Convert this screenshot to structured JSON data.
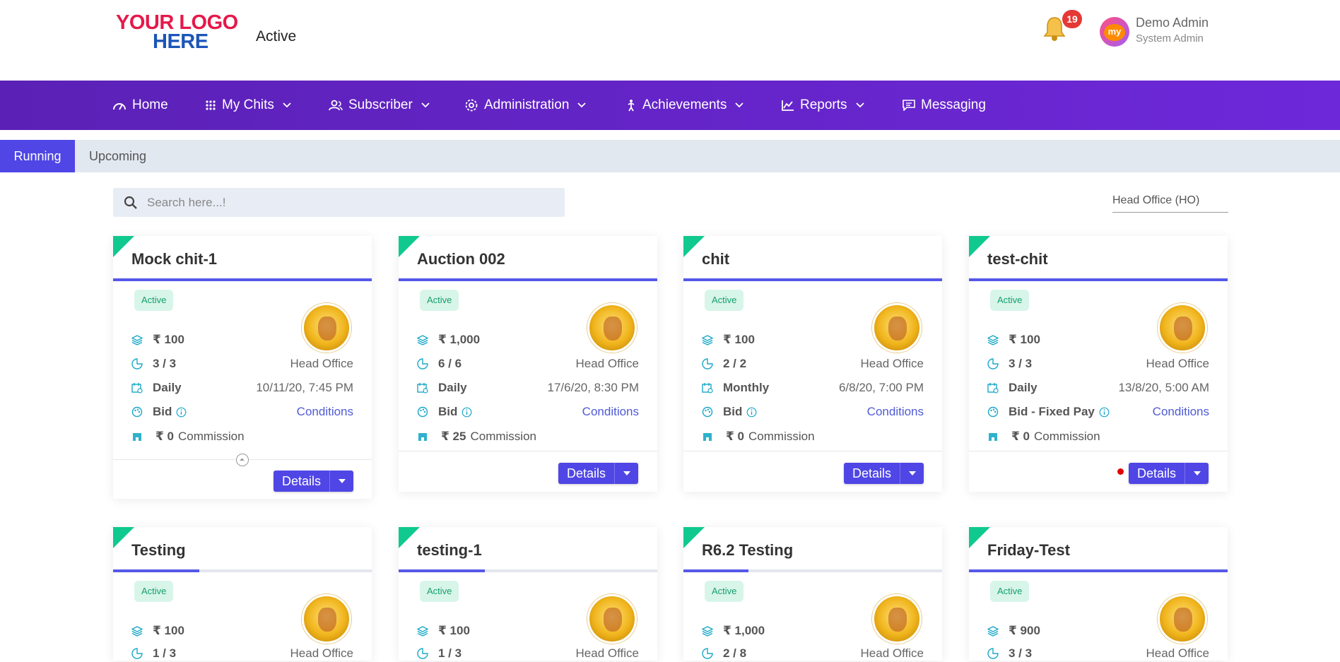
{
  "header": {
    "logo_line1": "YOUR LOGO",
    "logo_line2": "HERE",
    "page_status": "Active",
    "notifications_count": "19",
    "avatar_text": "my",
    "user_name": "Demo Admin",
    "user_role": "System Admin"
  },
  "nav": {
    "items": [
      {
        "label": "Home",
        "icon": "speedometer-icon"
      },
      {
        "label": "My Chits",
        "icon": "grid-icon"
      },
      {
        "label": "Subscriber",
        "icon": "users-icon"
      },
      {
        "label": "Administration",
        "icon": "gear-icon"
      },
      {
        "label": "Achievements",
        "icon": "trophy-icon"
      },
      {
        "label": "Reports",
        "icon": "chart-icon"
      },
      {
        "label": "Messaging",
        "icon": "message-icon"
      }
    ]
  },
  "tabs": {
    "running": "Running",
    "upcoming": "Upcoming"
  },
  "search": {
    "placeholder": "Search here...!"
  },
  "branch_filter": "Head Office (HO)",
  "cards": [
    {
      "title": "Mock chit-1",
      "status": "Active",
      "progress": 1.0,
      "amount": "₹ 100",
      "members": "3 / 3",
      "branch": "Head Office",
      "frequency": "Daily",
      "date": "10/11/20, 7:45 PM",
      "auction_type": "Bid",
      "conditions": "Conditions",
      "commission_value": "₹ 0",
      "commission_label": "Commission",
      "details": "Details"
    },
    {
      "title": "Auction 002",
      "status": "Active",
      "progress": 1.0,
      "amount": "₹ 1,000",
      "members": "6 / 6",
      "branch": "Head Office",
      "frequency": "Daily",
      "date": "17/6/20, 8:30 PM",
      "auction_type": "Bid",
      "conditions": "Conditions",
      "commission_value": "₹ 25",
      "commission_label": "Commission",
      "details": "Details"
    },
    {
      "title": "chit",
      "status": "Active",
      "progress": 1.0,
      "amount": "₹ 100",
      "members": "2 / 2",
      "branch": "Head Office",
      "frequency": "Monthly",
      "date": "6/8/20, 7:00 PM",
      "auction_type": "Bid",
      "conditions": "Conditions",
      "commission_value": "₹ 0",
      "commission_label": "Commission",
      "details": "Details"
    },
    {
      "title": "test-chit",
      "status": "Active",
      "progress": 1.0,
      "amount": "₹ 100",
      "members": "3 / 3",
      "branch": "Head Office",
      "frequency": "Daily",
      "date": "13/8/20, 5:00 AM",
      "auction_type": "Bid - Fixed Pay",
      "conditions": "Conditions",
      "commission_value": "₹ 0",
      "commission_label": "Commission",
      "details": "Details"
    },
    {
      "title": "Testing",
      "status": "Active",
      "progress": 0.333,
      "amount": "₹ 100",
      "members": "1 / 3",
      "branch": "Head Office"
    },
    {
      "title": "testing-1",
      "status": "Active",
      "progress": 0.333,
      "amount": "₹ 100",
      "members": "1 / 3",
      "branch": "Head Office"
    },
    {
      "title": "R6.2 Testing",
      "status": "Active",
      "progress": 0.25,
      "amount": "₹ 1,000",
      "members": "2 / 8",
      "branch": "Head Office"
    },
    {
      "title": "Friday-Test",
      "status": "Active",
      "progress": 1.0,
      "amount": "₹ 900",
      "members": "3 / 3",
      "branch": "Head Office"
    }
  ],
  "colors": {
    "nav": "#5b21b6",
    "accent": "#4f46e5",
    "active_badge": "#12a06a",
    "corner": "#10c98f"
  }
}
